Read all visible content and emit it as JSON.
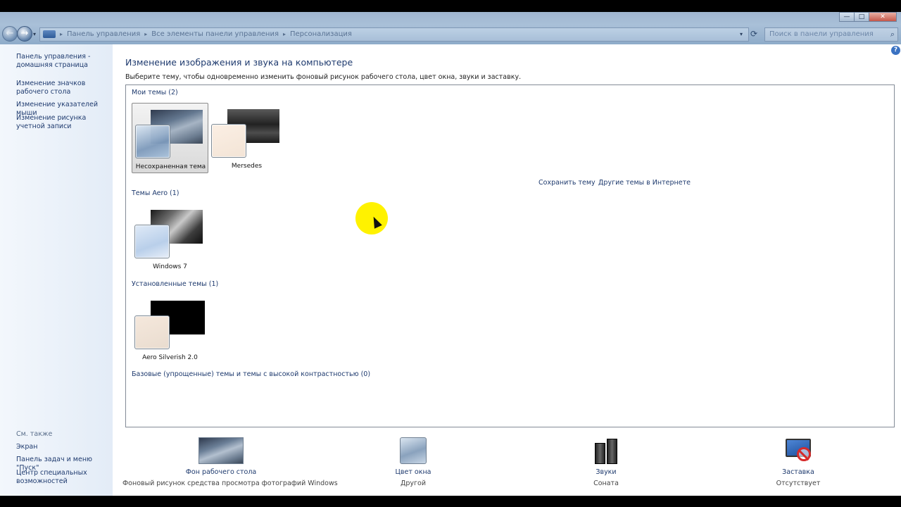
{
  "window": {
    "buttons": {
      "minimize": "—",
      "maximize": "□",
      "close": "✕"
    }
  },
  "nav": {
    "back_icon": "←",
    "forward_icon": "→",
    "breadcrumbs": [
      "Панель управления",
      "Все элементы панели управления",
      "Персонализация"
    ],
    "breadcrumb_sep": "▸",
    "dropdown_icon": "▾",
    "refresh_icon": "⟳",
    "search_placeholder": "Поиск в панели управления",
    "search_icon": "⌕"
  },
  "sidebar": {
    "home": "Панель управления - домашняя страница",
    "links": [
      "Изменение значков рабочего стола",
      "Изменение указателей мыши",
      "Изменение рисунка учетной записи"
    ],
    "see_also_label": "См. также",
    "see_also": [
      "Экран",
      "Панель задач и меню \"Пуск\"",
      "Центр специальных возможностей"
    ]
  },
  "help_icon": "?",
  "main": {
    "heading": "Изменение изображения и звука на компьютере",
    "subheading": "Выберите тему, чтобы одновременно изменить фоновый рисунок рабочего стола, цвет окна, звуки и заставку.",
    "save_theme": "Сохранить тему",
    "online_themes": "Другие темы в Интернете",
    "groups": {
      "my": {
        "title": "Мои темы (2)",
        "themes": [
          "Несохраненная тема",
          "Mersedes"
        ]
      },
      "aero": {
        "title": "Темы Aero (1)",
        "themes": [
          "Windows 7"
        ]
      },
      "installed": {
        "title": "Установленные темы (1)",
        "themes": [
          "Aero Silverish 2.0"
        ]
      },
      "basic": {
        "title": "Базовые (упрощенные) темы и темы с высокой контрастностью (0)"
      }
    },
    "selected_theme": "Несохраненная тема"
  },
  "bottom": {
    "background": {
      "label": "Фон рабочего стола",
      "value": "Фоновый рисунок средства просмотра фотографий Windows"
    },
    "color": {
      "label": "Цвет окна",
      "value": "Другой"
    },
    "sounds": {
      "label": "Звуки",
      "value": "Соната"
    },
    "saver": {
      "label": "Заставка",
      "value": "Отсутствует"
    }
  },
  "colors": {
    "link": "#1e3a6e",
    "cursor_highlight": "#fff200"
  }
}
